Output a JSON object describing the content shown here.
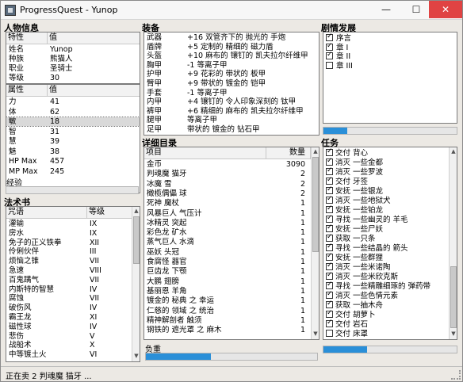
{
  "window": {
    "title": "ProgressQuest - Yunop",
    "minimize_glyph": "—",
    "maximize_glyph": "☐",
    "close_glyph": "✕"
  },
  "character": {
    "panel_title": "人物信息",
    "columns": [
      "特性",
      "值"
    ],
    "traits": [
      {
        "name": "姓名",
        "value": "Yunop"
      },
      {
        "name": "种族",
        "value": "熊猫人"
      },
      {
        "name": "职业",
        "value": "圣骑士"
      },
      {
        "name": "等级",
        "value": "30"
      }
    ],
    "stat_columns": [
      "属性",
      "值"
    ],
    "stats": [
      {
        "name": "力",
        "value": "41"
      },
      {
        "name": "体",
        "value": "62"
      },
      {
        "name": "敏",
        "value": "18"
      },
      {
        "name": "智",
        "value": "31"
      },
      {
        "name": "慧",
        "value": "39"
      },
      {
        "name": "魅",
        "value": "38"
      },
      {
        "name": "HP Max",
        "value": "457"
      },
      {
        "name": "MP Max",
        "value": "245"
      }
    ],
    "selected_stat_index": 2,
    "experience_label": "经验",
    "experience_progress": 0.0
  },
  "spells": {
    "panel_title": "法术书",
    "columns": [
      "咒语",
      "等级"
    ],
    "items": [
      {
        "name": "灌输",
        "level": "IX"
      },
      {
        "name": "房水",
        "level": "IX"
      },
      {
        "name": "免子的正义铁拳",
        "level": "XII"
      },
      {
        "name": "伶俐伙伴",
        "level": "III"
      },
      {
        "name": "烦恼之锥",
        "level": "VII"
      },
      {
        "name": "急速",
        "level": "VIII"
      },
      {
        "name": "百鬼蹒气",
        "level": "VII"
      },
      {
        "name": "内斯特的智慧",
        "level": "IV"
      },
      {
        "name": "腐蚀",
        "level": "VII"
      },
      {
        "name": "破伤风",
        "level": "IV"
      },
      {
        "name": "霸王龙",
        "level": "XI"
      },
      {
        "name": "磁性球",
        "level": "IV"
      },
      {
        "name": "悲伤",
        "level": "V"
      },
      {
        "name": "战船术",
        "level": "X"
      },
      {
        "name": "中等镀土火",
        "level": "VI"
      }
    ]
  },
  "equipment": {
    "panel_title": "装备",
    "items": [
      {
        "slot": "武器",
        "item": "+16 双管齐下的 抛光的 手炮"
      },
      {
        "slot": "盾牌",
        "item": "+5 定制的 精细的 磁力盾"
      },
      {
        "slot": "头盔",
        "item": "+10 麻布的 镶钉的 凯夫拉尔纤维甲"
      },
      {
        "slot": "胸甲",
        "item": "-1 等离子甲"
      },
      {
        "slot": "护甲",
        "item": "+9 花彩的 带状的 板甲"
      },
      {
        "slot": "臂甲",
        "item": "+9 带状的 镀金的 铠甲"
      },
      {
        "slot": "手套",
        "item": "-1 等离子甲"
      },
      {
        "slot": "内甲",
        "item": "+4 镶钉的 令人印象深刻的 钛甲"
      },
      {
        "slot": "裤甲",
        "item": "+6 精细的 麻布的 凯夫拉尔纤维甲"
      },
      {
        "slot": "腿甲",
        "item": "等离子甲"
      },
      {
        "slot": "足甲",
        "item": "带状的 镀金的 钻石甲"
      }
    ]
  },
  "inventory": {
    "panel_title": "详细目录",
    "columns": [
      "项目",
      "数量"
    ],
    "items": [
      {
        "name": "金币",
        "qty": "3090"
      },
      {
        "name": "判魂魔 猫牙",
        "qty": "2"
      },
      {
        "name": "冰魔 雪",
        "qty": "2"
      },
      {
        "name": "橄榄偶儡 球",
        "qty": "2"
      },
      {
        "name": "死神 魔杖",
        "qty": "1"
      },
      {
        "name": "风暴巨人 气压计",
        "qty": "1"
      },
      {
        "name": "冰精灵 突起",
        "qty": "1"
      },
      {
        "name": "彩色龙 矿水",
        "qty": "1"
      },
      {
        "name": "蒸气巨人 水滴",
        "qty": "1"
      },
      {
        "name": "巫妖 头冠",
        "qty": "1"
      },
      {
        "name": "食腐怪 器官",
        "qty": "1"
      },
      {
        "name": "巨齿龙 下颚",
        "qty": "1"
      },
      {
        "name": "大鹏 翅膀",
        "qty": "1"
      },
      {
        "name": "基丽恩 羊角",
        "qty": "1"
      },
      {
        "name": "镀金的 秘典 之 幸运",
        "qty": "1"
      },
      {
        "name": "仁慈的 领域 之 统治",
        "qty": "1"
      },
      {
        "name": "精神解剖者 触须",
        "qty": "1"
      },
      {
        "name": "钢铁的 遮光罩 之 麻木",
        "qty": "1"
      }
    ],
    "encumbrance_label": "负重",
    "encumbrance_progress": 0.38
  },
  "plot": {
    "panel_title": "剧情发展",
    "items": [
      {
        "label": "序言",
        "checked": true
      },
      {
        "label": "章 I",
        "checked": true
      },
      {
        "label": "章 II",
        "checked": true
      },
      {
        "label": "章 III",
        "checked": false
      }
    ],
    "progress": 0.18
  },
  "quests": {
    "panel_title": "任务",
    "items": [
      {
        "label": "交付 背心",
        "checked": true
      },
      {
        "label": "消灭 一些金都",
        "checked": true
      },
      {
        "label": "消灭 一些罗波",
        "checked": true
      },
      {
        "label": "交付 牙签",
        "checked": true
      },
      {
        "label": "安抚 一些银龙",
        "checked": true
      },
      {
        "label": "消灭 一些地狱犬",
        "checked": true
      },
      {
        "label": "安抚 一些铂龙",
        "checked": true
      },
      {
        "label": "寻找 一些幽灵的 羊毛",
        "checked": true
      },
      {
        "label": "安抚 一些尸妖",
        "checked": true
      },
      {
        "label": "获取 一只条",
        "checked": true
      },
      {
        "label": "寻找 一些结晶的 箭头",
        "checked": true
      },
      {
        "label": "安抚 一些群狸",
        "checked": true
      },
      {
        "label": "消灭 一些米诺陶",
        "checked": true
      },
      {
        "label": "消灭 一些米欣克斯",
        "checked": true
      },
      {
        "label": "寻找 一些精雕细琢的 弹药带",
        "checked": true
      },
      {
        "label": "消灭 一些色情元素",
        "checked": true
      },
      {
        "label": "获取 一抽木舟",
        "checked": true
      },
      {
        "label": "交付 胡萝卜",
        "checked": true
      },
      {
        "label": "交付 岩石",
        "checked": true
      },
      {
        "label": "交付 床罩",
        "checked": false
      }
    ],
    "progress": 0.33
  },
  "status": {
    "text": "正在卖 2 判魂魔 猫牙 ..."
  },
  "colors": {
    "progress_fill": "#2a8fd8",
    "close_button": "#e04343"
  }
}
